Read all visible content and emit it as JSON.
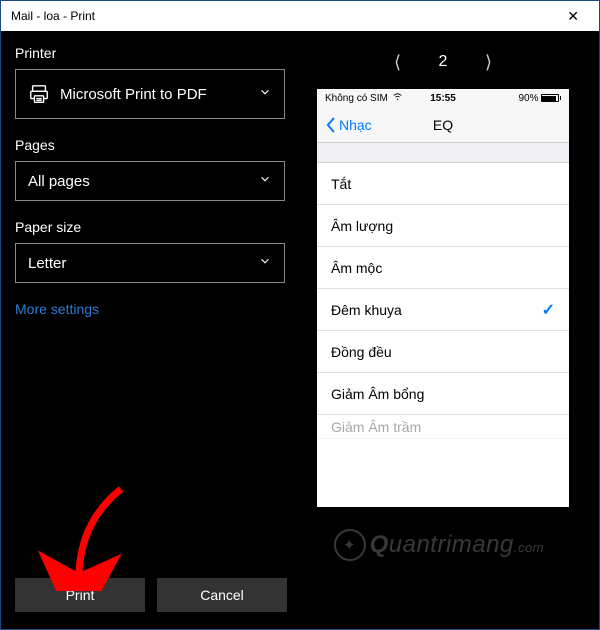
{
  "titlebar": {
    "title": "Mail - loa - Print"
  },
  "left": {
    "printer": {
      "label": "Printer",
      "value": "Microsoft Print to PDF"
    },
    "pages": {
      "label": "Pages",
      "value": "All pages"
    },
    "papersize": {
      "label": "Paper size",
      "value": "Letter"
    },
    "more": "More settings"
  },
  "pager": {
    "page": "2"
  },
  "preview": {
    "status": {
      "carrier": "Không có SIM",
      "time": "15:55",
      "battery": "90%"
    },
    "nav": {
      "back": "Nhạc",
      "title": "EQ"
    },
    "rows": [
      "Tắt",
      "Âm lượng",
      "Âm mộc",
      "Đêm khuya",
      "Đồng đều",
      "Giảm Âm bổng",
      "Giảm Âm trầm"
    ],
    "checked_index": 3
  },
  "footer": {
    "print": "Print",
    "cancel": "Cancel"
  },
  "watermark": "uantrimang"
}
